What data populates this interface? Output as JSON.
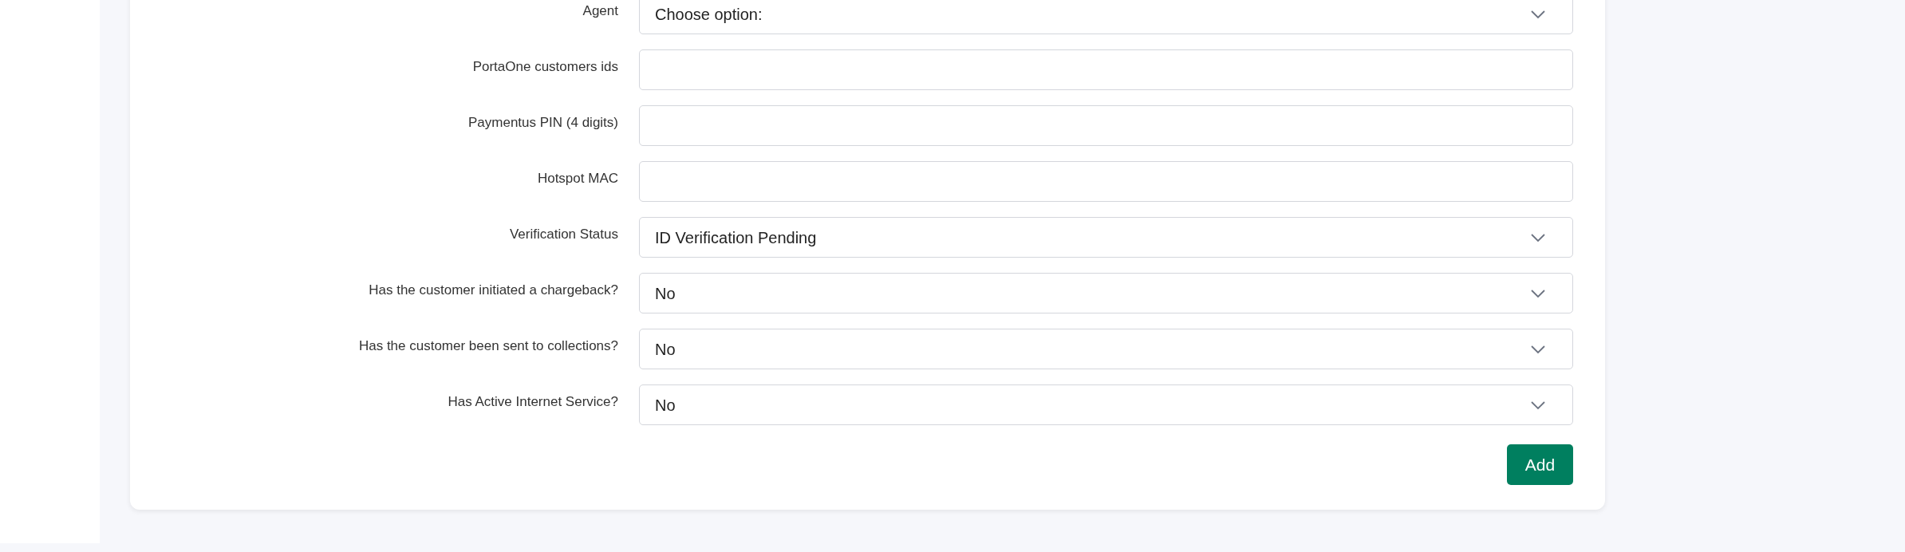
{
  "form": {
    "fields": [
      {
        "label": "Agent",
        "kind": "select",
        "value": "Choose option:"
      },
      {
        "label": "PortaOne customers ids",
        "kind": "text"
      },
      {
        "label": "Paymentus PIN (4 digits)",
        "kind": "text"
      },
      {
        "label": "Hotspot MAC",
        "kind": "text"
      },
      {
        "label": "Verification Status",
        "kind": "select",
        "value": "ID Verification Pending"
      },
      {
        "label": "Has the customer initiated a chargeback?",
        "kind": "select",
        "value": "No"
      },
      {
        "label": "Has the customer been sent to collections?",
        "kind": "select",
        "value": "No"
      },
      {
        "label": "Has Active Internet Service?",
        "kind": "select",
        "value": "No"
      }
    ],
    "submit": "Add"
  }
}
